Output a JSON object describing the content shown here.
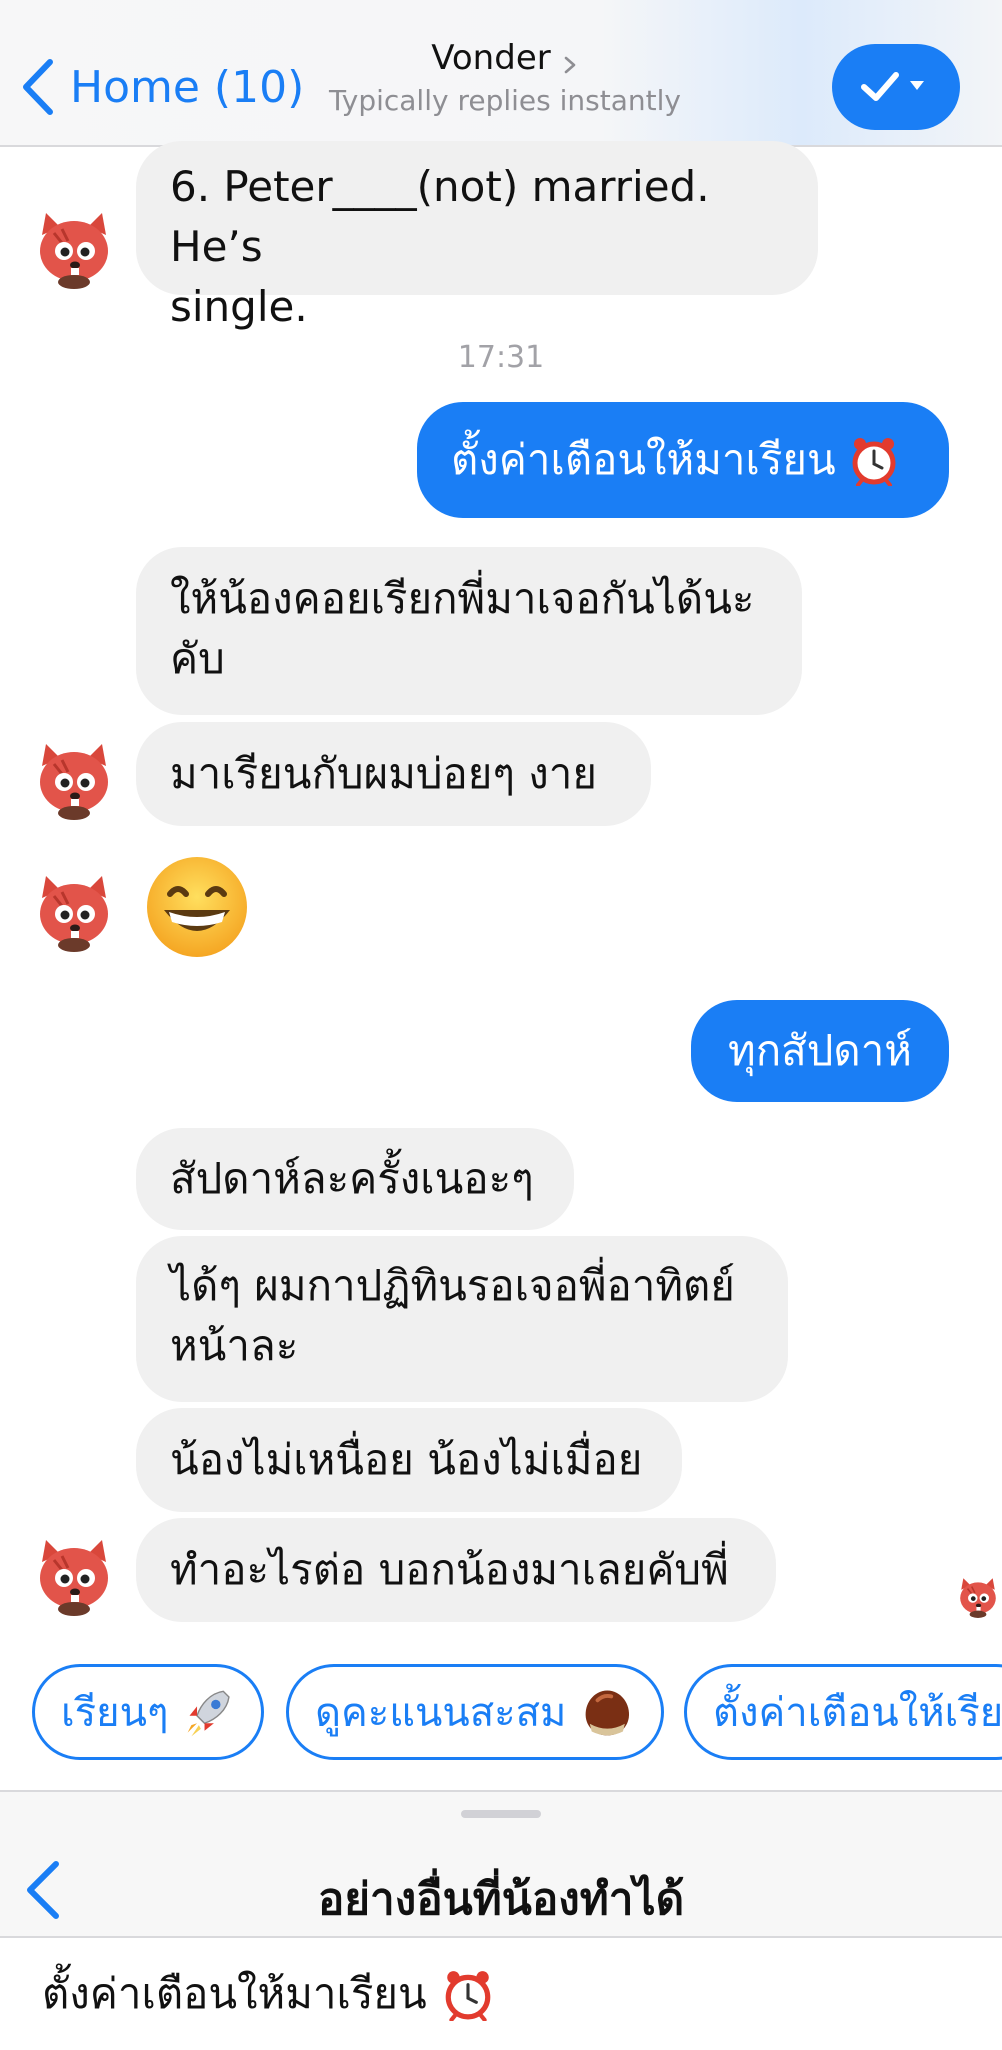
{
  "header": {
    "back_label": "Home (10)",
    "title": "Vonder",
    "subtitle": "Typically replies instantly",
    "accent_color": "#1a7ef5"
  },
  "chat": {
    "timestamp": "17:31",
    "messages": [
      {
        "from": "bot",
        "lines": [
          "6. Peter____(not) married. He’s",
          "single."
        ]
      },
      {
        "from": "user",
        "text": "ตั้งค่าเตือนให้มาเรียน",
        "emoji": "alarm-clock"
      },
      {
        "from": "bot",
        "lines": [
          "ให้น้องคอยเรียกพี่มาเจอกันได้นะ",
          "คับ"
        ]
      },
      {
        "from": "bot",
        "text": "มาเรียนกับผมบ่อยๆ งาย"
      },
      {
        "from": "bot",
        "emoji": "grinning-face"
      },
      {
        "from": "user",
        "text": "ทุกสัปดาห์"
      },
      {
        "from": "bot",
        "text": "สัปดาห์ละครั้งเนอะๆ"
      },
      {
        "from": "bot",
        "lines": [
          "ได้ๆ ผมกาปฏิทินรอเจอพี่อาทิตย์",
          "หน้าละ"
        ]
      },
      {
        "from": "bot",
        "text": "น้องไม่เหนื่อย น้องไม่เมื่อย"
      },
      {
        "from": "bot",
        "text": "ทำอะไรต่อ บอกน้องมาเลยคับพี่"
      }
    ]
  },
  "quick_replies": [
    {
      "label": "เรียนๆ",
      "icon": "rocket-icon"
    },
    {
      "label": "ดูคะแนนสะสม",
      "icon": "chestnut-icon"
    },
    {
      "label": "ตั้งค่าเตือนให้เรีย",
      "icon": ""
    }
  ],
  "menu": {
    "title": "อย่างอื่นที่น้องทำได้",
    "items": [
      {
        "label": "ตั้งค่าเตือนให้มาเรียน",
        "icon": "alarm-clock-icon"
      }
    ]
  }
}
